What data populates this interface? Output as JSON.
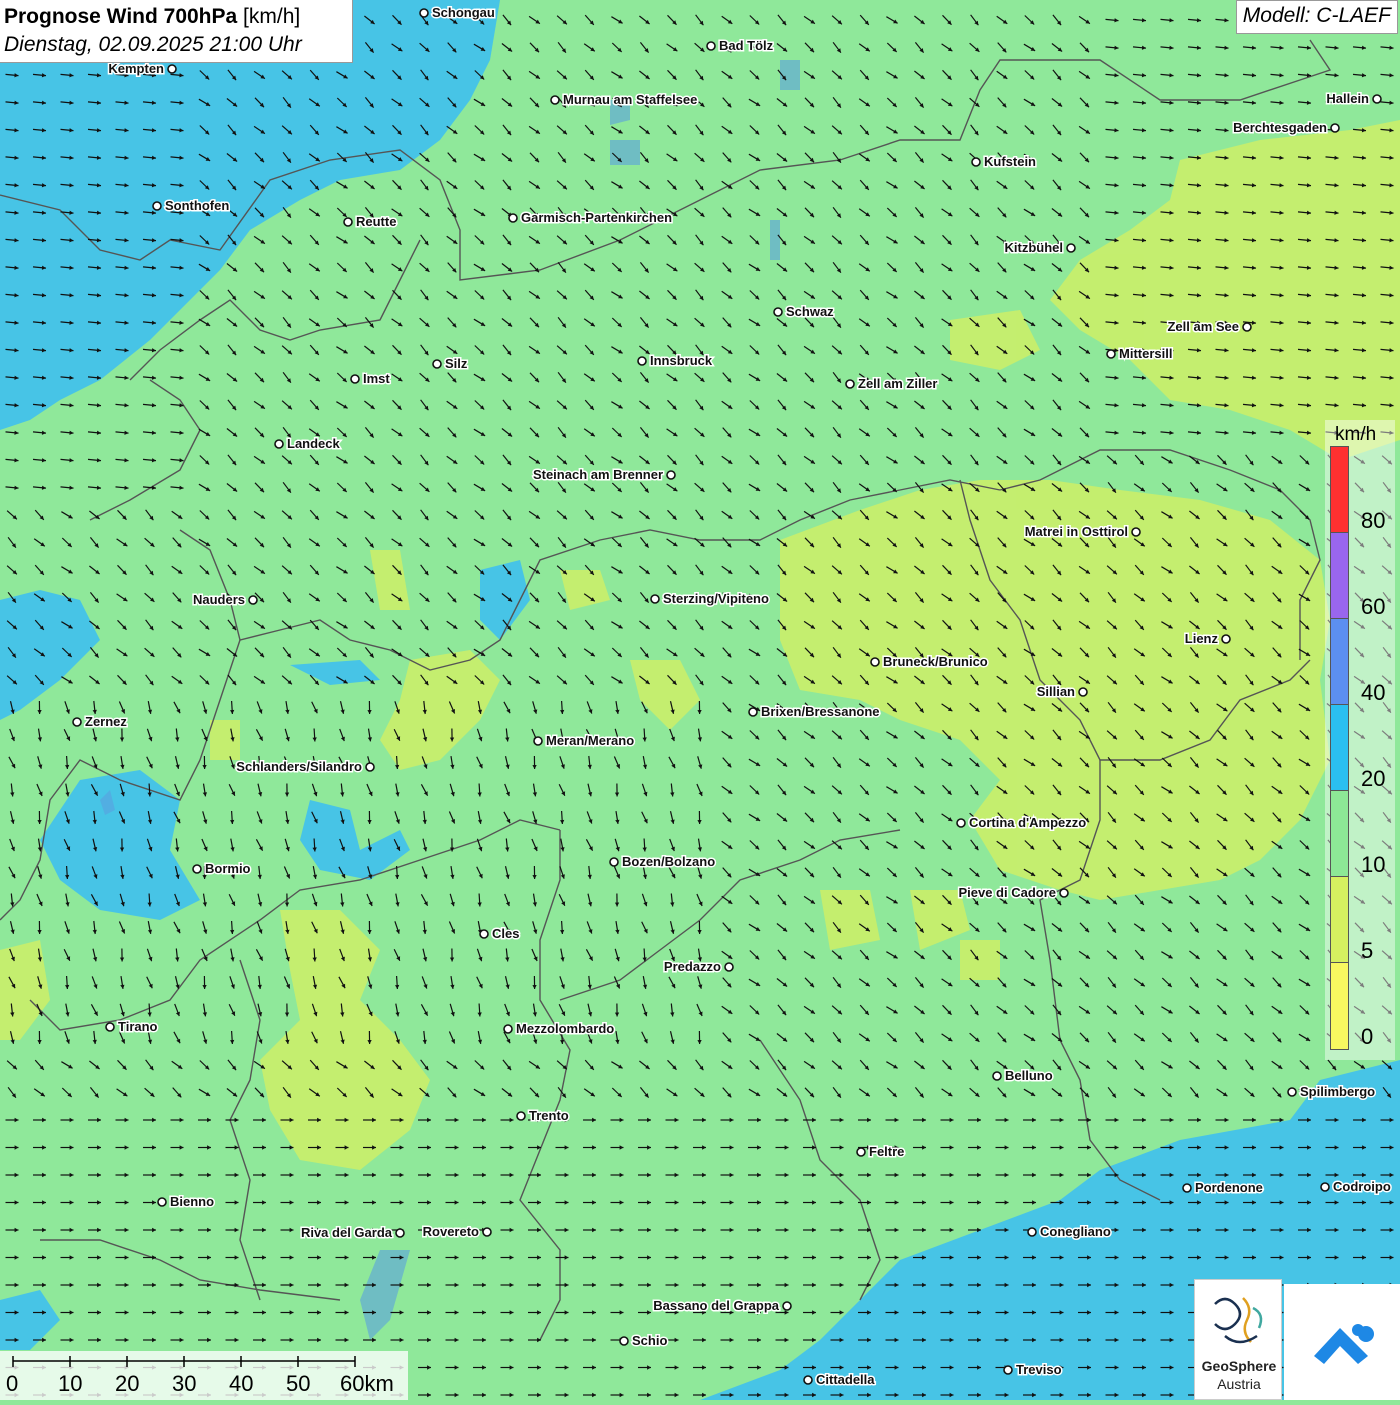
{
  "header": {
    "title_bold": "Prognose Wind 700hPa",
    "title_unit": "[km/h]",
    "subtitle": "Dienstag, 02.09.2025 21:00 Uhr"
  },
  "model_label": "Modell: C-LAEF",
  "legend": {
    "unit": "km/h",
    "labels": [
      "80",
      "60",
      "40",
      "20",
      "10",
      "5",
      "0"
    ],
    "colors": [
      "#ff3030",
      "#9966ee",
      "#5c8ff0",
      "#2bbff0",
      "#8de896",
      "#d6f060",
      "#f8f860"
    ]
  },
  "scale_bar": {
    "labels": [
      "0",
      "10",
      "20",
      "30",
      "40",
      "50",
      "60km"
    ]
  },
  "cities": [
    "Schongau",
    "Bad Tölz",
    "Kempten",
    "Murnau am Staffelsee",
    "Hallein",
    "Berchtesgaden",
    "Kufstein",
    "Sonthofen",
    "Reutte",
    "Garmisch-Partenkirchen",
    "Kitzbühel",
    "Schwaz",
    "Zell am See",
    "Mittersill",
    "Innsbruck",
    "Silz",
    "Imst",
    "Zell am Ziller",
    "Landeck",
    "Steinach am Brenner",
    "Matrei in Osttirol",
    "Nauders",
    "Sterzing/Vipiteno",
    "Lienz",
    "Bruneck/Brunico",
    "Sillian",
    "Zernez",
    "Brixen/Bressanone",
    "Meran/Merano",
    "Schlanders/Silandro",
    "Cortina d'Ampezzo",
    "Bozen/Bolzano",
    "Bormio",
    "Pieve di Cadore",
    "Cles",
    "Predazzo",
    "Tirano",
    "Mezzolombardo",
    "Belluno",
    "Spilimbergo",
    "Trento",
    "Feltre",
    "Pordenone",
    "Codroipo",
    "Bienno",
    "Riva del Garda",
    "Rovereto",
    "Conegliano",
    "Bassano del Grappa",
    "Schio",
    "Treviso",
    "Cittadella"
  ],
  "logos": {
    "geosphere_line1": "GeoSphere",
    "geosphere_line2": "Austria"
  },
  "colors": {
    "wind_low": "#f8f860",
    "wind_5": "#d6f060",
    "wind_10": "#8de896",
    "wind_20": "#2bbff0",
    "arrow": "#000000"
  }
}
